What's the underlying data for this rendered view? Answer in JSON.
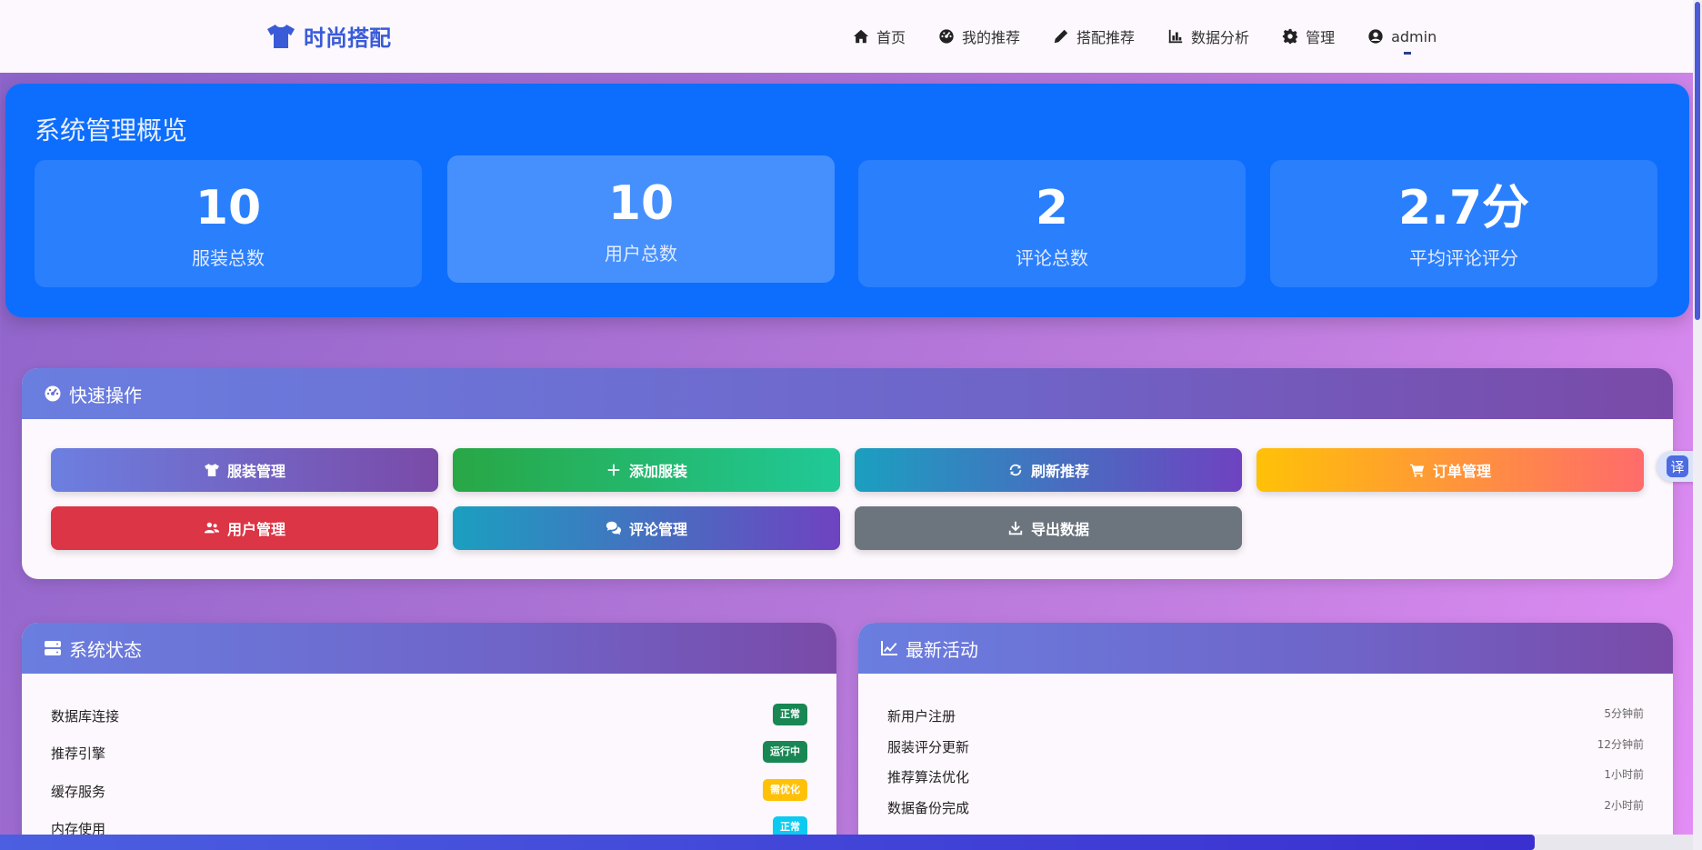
{
  "brand": {
    "name": "时尚搭配"
  },
  "nav": {
    "items": [
      {
        "label": "首页",
        "icon": "home-icon"
      },
      {
        "label": "我的推荐",
        "icon": "dashboard-icon"
      },
      {
        "label": "搭配推荐",
        "icon": "pencil-icon"
      },
      {
        "label": "数据分析",
        "icon": "chart-bar-icon"
      },
      {
        "label": "管理",
        "icon": "gear-icon"
      },
      {
        "label": "admin",
        "icon": "user-circle-icon"
      }
    ]
  },
  "overview": {
    "title": "系统管理概览",
    "stats": [
      {
        "value": "10",
        "label": "服装总数"
      },
      {
        "value": "10",
        "label": "用户总数"
      },
      {
        "value": "2",
        "label": "评论总数"
      },
      {
        "value": "2.7分",
        "label": "平均评论评分"
      }
    ]
  },
  "quick": {
    "title": "快速操作",
    "buttons": [
      {
        "label": "服装管理"
      },
      {
        "label": "添加服装"
      },
      {
        "label": "刷新推荐"
      },
      {
        "label": "订单管理"
      },
      {
        "label": "用户管理"
      },
      {
        "label": "评论管理"
      },
      {
        "label": "导出数据"
      }
    ]
  },
  "system": {
    "title": "系统状态",
    "rows": [
      {
        "label": "数据库连接",
        "status": "正常",
        "color": "#198754"
      },
      {
        "label": "推荐引擎",
        "status": "运行中",
        "color": "#198754"
      },
      {
        "label": "缓存服务",
        "status": "需优化",
        "color": "#ffc107"
      },
      {
        "label": "内存使用",
        "status": "正常",
        "color": "#0dcaf0"
      }
    ]
  },
  "activity": {
    "title": "最新活动",
    "rows": [
      {
        "label": "新用户注册",
        "time": "5分钟前"
      },
      {
        "label": "服装评分更新",
        "time": "12分钟前"
      },
      {
        "label": "推荐算法优化",
        "time": "1小时前"
      },
      {
        "label": "数据备份完成",
        "time": "2小时前"
      }
    ]
  },
  "translate": {
    "label": "译"
  }
}
